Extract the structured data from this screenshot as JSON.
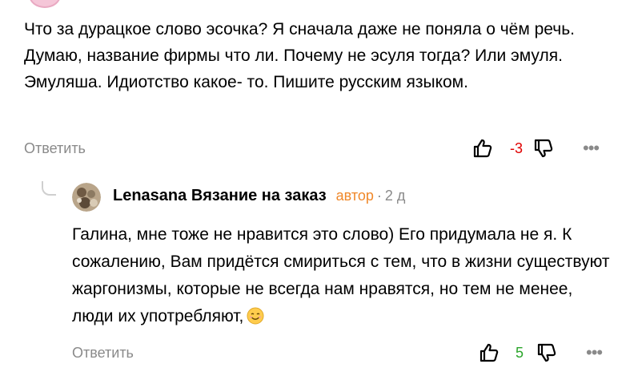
{
  "comment": {
    "text": "Что за дурацкое слово эсочка? Я сначала даже не поняла о чём речь. Думаю, название фирмы что ли. Почему не эсуля тогда? Или эмуля. Эмуляша. Идиотство какое- то. Пишите русским языком.",
    "reply_label": "Ответить",
    "score": "-3",
    "score_color": "#e00000",
    "more_label": "•••"
  },
  "reply": {
    "author": "Lenasana Вязание на заказ",
    "author_badge": "автор",
    "separator": "·",
    "time": "2 д",
    "text": "Галина, мне тоже не нравится это слово) Его придумала не я. К сожалению, Вам придётся смириться с тем, что в жизни существуют жаргонизмы, которые не всегда нам нравятся, но тем не менее, люди их употребляют,",
    "emoji": "smiling-face-emoji",
    "reply_label": "Ответить",
    "score": "5",
    "score_color": "#2aa52a",
    "more_label": "•••"
  },
  "icons": {
    "like": "thumbs-up-icon",
    "dislike": "thumbs-down-icon",
    "more": "more-dots-icon"
  }
}
